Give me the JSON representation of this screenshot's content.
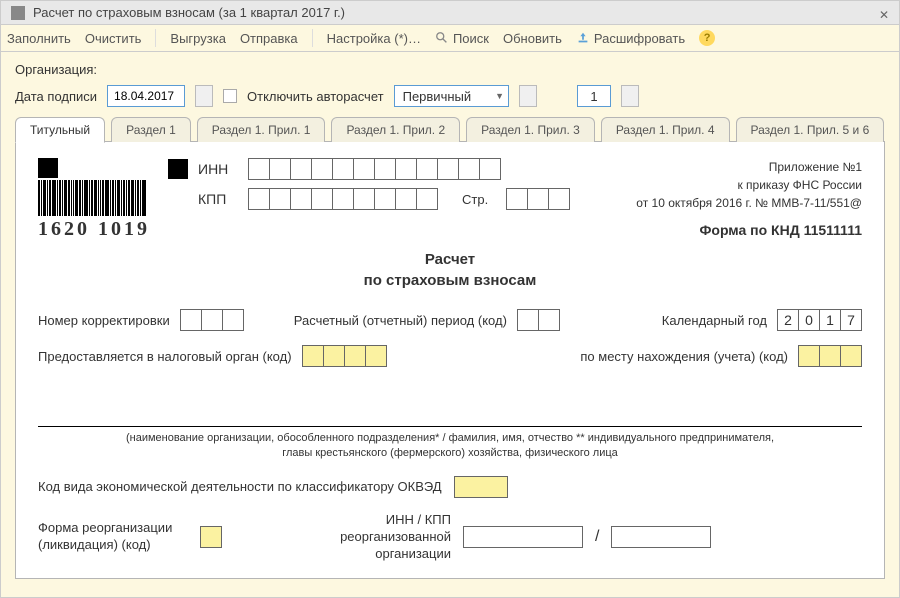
{
  "titlebar": {
    "text": "Расчет по страховым взносам (за 1 квартал 2017 г.)"
  },
  "toolbar": {
    "fill": "Заполнить",
    "clear": "Очистить",
    "export": "Выгрузка",
    "send": "Отправка",
    "settings": "Настройка (*)…",
    "search": "Поиск",
    "refresh": "Обновить",
    "decrypt": "Расшифровать"
  },
  "meta": {
    "org_label": "Организация:",
    "sign_date_label": "Дата подписи",
    "sign_date": "18.04.2017",
    "autocalc_label": "Отключить авторасчет",
    "primary": "Первичный",
    "correction_num": "1"
  },
  "tabs": [
    {
      "label": "Титульный",
      "active": true
    },
    {
      "label": "Раздел 1"
    },
    {
      "label": "Раздел 1. Прил. 1"
    },
    {
      "label": "Раздел 1. Прил. 2"
    },
    {
      "label": "Раздел 1. Прил. 3"
    },
    {
      "label": "Раздел 1. Прил. 4"
    },
    {
      "label": "Раздел 1. Прил. 5 и 6"
    }
  ],
  "form": {
    "barcode": "1620 1019",
    "inn_label": "ИНН",
    "kpp_label": "КПП",
    "page_label": "Стр.",
    "right1": "Приложение №1",
    "right2": "к приказу ФНС России",
    "right3": "от 10 октября 2016 г. № ММВ-7-11/551@",
    "knd": "Форма по КНД 11511111",
    "title1": "Расчет",
    "title2": "по страховым взносам",
    "corr_label": "Номер корректировки",
    "period_label": "Расчетный (отчетный) период (код)",
    "year_label": "Календарный год",
    "year": [
      "2",
      "0",
      "1",
      "7"
    ],
    "tax_label": "Предоставляется в налоговый орган (код)",
    "place_label": "по месту нахождения (учета) (код)",
    "note": "(наименование организации, обособленного подразделения* / фамилия, имя, отчество ** индивидуального предпринимателя,\nглавы крестьянского (фермерского) хозяйства, физического лица",
    "okved_label": "Код вида экономической деятельности по классификатору ОКВЭД",
    "reorg_left": "Форма реорганизации (ликвидация) (код)",
    "reorg_right": "ИНН / КПП реорганизованной организации"
  }
}
